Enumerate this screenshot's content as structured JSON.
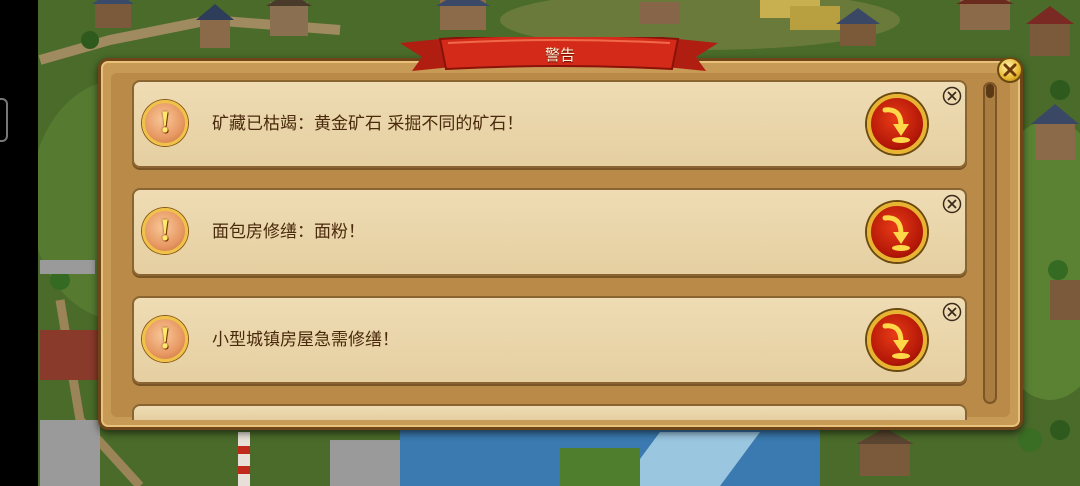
{
  "dialog": {
    "title": "警告",
    "close_icon": "close-icon"
  },
  "alerts": [
    {
      "message": "矿藏已枯竭：黄金矿石 采掘不同的矿石！",
      "icon": "warning-icon",
      "action_icon": "goto-arrow-icon",
      "dismiss_icon": "dismiss-icon"
    },
    {
      "message": "面包房修缮：面粉！",
      "icon": "warning-icon",
      "action_icon": "goto-arrow-icon",
      "dismiss_icon": "dismiss-icon"
    },
    {
      "message": "小型城镇房屋急需修缮！",
      "icon": "warning-icon",
      "action_icon": "goto-arrow-icon",
      "dismiss_icon": "dismiss-icon"
    }
  ],
  "warn_glyph": "!",
  "colors": {
    "ribbon": "#d22a1c",
    "panel": "#c79a55",
    "row_bg": "#efdcb4",
    "text": "#4a2a0c",
    "goto_button": "#b41808",
    "gold_trim": "#e8b330"
  }
}
